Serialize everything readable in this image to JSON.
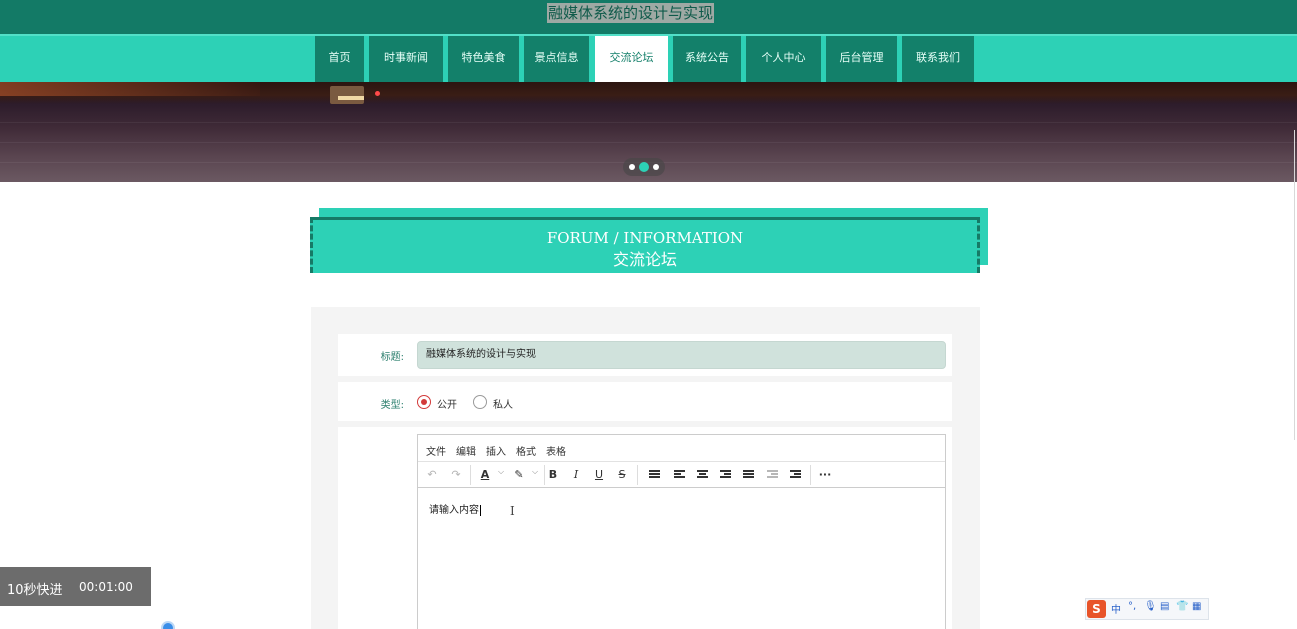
{
  "header": {
    "site_title": "融媒体系统的设计与实现"
  },
  "nav": {
    "items": [
      {
        "label": "首页",
        "active": false
      },
      {
        "label": "时事新闻",
        "active": false
      },
      {
        "label": "特色美食",
        "active": false
      },
      {
        "label": "景点信息",
        "active": false
      },
      {
        "label": "交流论坛",
        "active": true
      },
      {
        "label": "系统公告",
        "active": false
      },
      {
        "label": "个人中心",
        "active": false
      },
      {
        "label": "后台管理",
        "active": false
      },
      {
        "label": "联系我们",
        "active": false
      }
    ]
  },
  "carousel": {
    "slide_count": 3,
    "active_index": 1
  },
  "section": {
    "title_en": "FORUM / INFORMATION",
    "title_cn": "交流论坛"
  },
  "form": {
    "title_label": "标题:",
    "title_value": "融媒体系统的设计与实现",
    "type_label": "类型:",
    "type_options": [
      "公开",
      "私人"
    ],
    "type_selected": "公开"
  },
  "editor": {
    "menu": [
      "文件",
      "编辑",
      "插入",
      "格式",
      "表格"
    ],
    "toolbar_icons": [
      "undo-icon",
      "redo-icon",
      "font-color-icon",
      "highlight-icon",
      "bold-icon",
      "italic-icon",
      "underline-icon",
      "strikethrough-icon",
      "numbered-list-icon",
      "align-left-icon",
      "align-center-icon",
      "align-right-icon",
      "justify-icon",
      "outdent-icon",
      "indent-icon",
      "more-icon"
    ],
    "content": "请输入内容"
  },
  "video_overlay": {
    "fast_forward": "10秒快进",
    "time": "00:01:00"
  },
  "ime": {
    "logo": "S",
    "mode": "中"
  },
  "colors": {
    "primary": "#2dd1b6",
    "dark": "#13806a",
    "header": "#137a66"
  }
}
